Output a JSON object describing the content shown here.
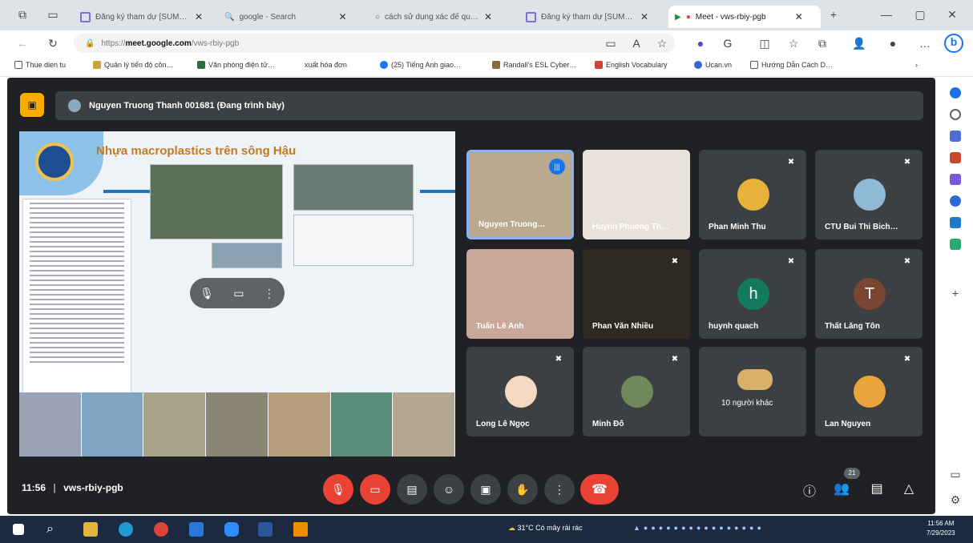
{
  "browser": {
    "tabs": [
      {
        "label": "Đăng ký tham dự [SUMM…",
        "active": false
      },
      {
        "label": "google - Search",
        "active": false
      },
      {
        "label": "cách sử dụng xác để quay …",
        "active": false
      },
      {
        "label": "Đăng ký tham dự [SUMM…",
        "active": false
      },
      {
        "label": "Meet - vws-rbiy-pgb",
        "active": true
      }
    ],
    "url_prefix": "https://",
    "url_host": "meet.google.com",
    "url_path": "/vws-rbiy-pgb",
    "bookmarks": [
      "Thue dien tu",
      "Quản lý tiến độ côn…",
      "Văn phòng điện tử…",
      "xuất hóa đơn",
      "(25) Tiếng Anh giao…",
      "Randall's ESL Cyber…",
      "English Vocabulary",
      "Ucan.vn",
      "Hướng Dẫn Cách D…"
    ]
  },
  "meet": {
    "presenter_label": "Nguyen Truong Thanh 001681 (Đang trình bày)",
    "slide_title": "Nhựa macroplastics trên sông Hậu",
    "meeting_time": "11:56",
    "meeting_code": "vws-rbiy-pgb",
    "participant_count": "21",
    "participants": [
      {
        "name": "Nguyen Truong…",
        "type": "video",
        "color": "#b8a98f",
        "speaking": true
      },
      {
        "name": "Huynh Phuong Th…",
        "type": "video",
        "color": "#e9e2d8",
        "speaking": false
      },
      {
        "name": "Phan Minh Thu",
        "type": "avatar",
        "initial": "",
        "color": "#e7b23a",
        "speaking": false
      },
      {
        "name": "CTU Bui Thi Bich…",
        "type": "avatar",
        "initial": "",
        "color": "#8fb9d6",
        "speaking": false
      },
      {
        "name": "Tuấn Lê Anh",
        "type": "video",
        "color": "#c9a79b",
        "speaking": false
      },
      {
        "name": "Phan Văn Nhiều",
        "type": "video",
        "color": "#2e2a22",
        "speaking": false
      },
      {
        "name": "huynh quach",
        "type": "avatar",
        "initial": "h",
        "color": "#137a5f",
        "speaking": false
      },
      {
        "name": "Thất Lăng Tôn",
        "type": "avatar",
        "initial": "T",
        "color": "#7a4532",
        "speaking": false
      },
      {
        "name": "Long Lê Ngọc",
        "type": "avatar",
        "initial": "",
        "color": "#f2d9c0",
        "speaking": false
      },
      {
        "name": "Minh Đỗ",
        "type": "avatar",
        "initial": "",
        "color": "#6e8a5b",
        "speaking": false
      },
      {
        "name": "10 người khác",
        "type": "group",
        "initial": "",
        "color": "#d7b06b",
        "speaking": false
      },
      {
        "name": "Lan Nguyen",
        "type": "avatar",
        "initial": "",
        "color": "#e9a43b",
        "speaking": false
      }
    ]
  },
  "taskbar": {
    "weather": "31°C  Có mây rải rác",
    "time": "11:56 AM",
    "date": "7/29/2023"
  }
}
